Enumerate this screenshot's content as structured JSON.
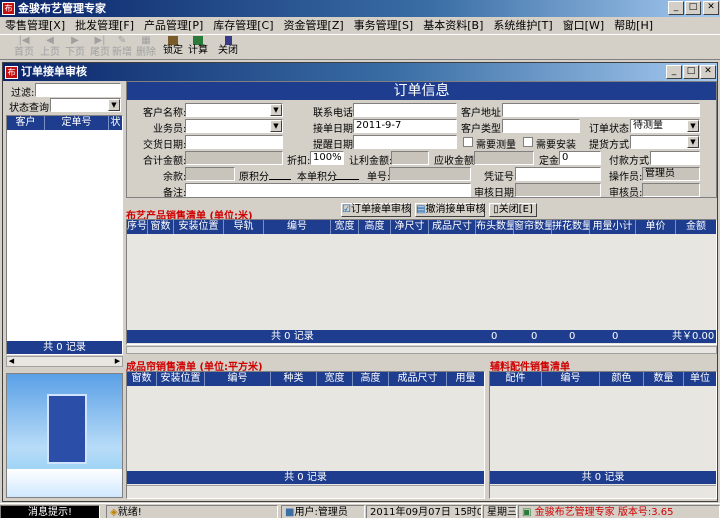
{
  "app": {
    "title": "金骏布艺管理专家"
  },
  "menu": [
    "零售管理[X]",
    "批发管理[F]",
    "产品管理[P]",
    "库存管理[C]",
    "资金管理[Z]",
    "事务管理[S]",
    "基本资料[B]",
    "系统维护[T]",
    "窗口[W]",
    "帮助[H]"
  ],
  "toolbar": {
    "first": "首页",
    "prev": "上页",
    "next": "下页",
    "last": "尾页",
    "add": "新增",
    "delete": "删除",
    "lock": "锁定",
    "calc": "计算",
    "close": "关闭"
  },
  "window": {
    "title": "订单接单审核"
  },
  "left": {
    "filter_label": "过滤:",
    "status_label": "状态查询:",
    "columns": [
      "客户",
      "定单号",
      "状"
    ],
    "footer": "共 0 记录"
  },
  "order": {
    "title": "订单信息",
    "customer_name": "客户名称:",
    "contact_phone": "联系电话:",
    "customer_address": "客户地址:",
    "salesman": "业务员:",
    "order_date": "接单日期:",
    "order_date_value": "2011-9-7",
    "customer_type": "客户类型:",
    "order_status": "订单状态:",
    "order_status_value": "待测量",
    "delivery_date": "交货日期:",
    "remind_date": "提醒日期:",
    "need_measure": "需要测量",
    "need_install": "需要安装",
    "pickup_method": "提货方式:",
    "total_amount": "合计金额:",
    "discount": "折扣:",
    "discount_value": "100%",
    "concession": "让利金额:",
    "receivable": "应收金额:",
    "deposit": "定金:",
    "deposit_value": "0",
    "payment_method": "付款方式:",
    "balance": "余款:",
    "original_points": "原积分",
    "this_points": "本单积分",
    "doc_no": "单号:",
    "voucher_no": "凭证号:",
    "operator": "操作员:",
    "operator_value": "管理员",
    "remark": "备注:",
    "audit_date": "审核日期:",
    "auditor": "审核员:"
  },
  "fabric": {
    "title": "布艺产品销售清单 (单位:米)",
    "btn_audit": "订单接单审核",
    "btn_cancel": "撤消接单审核",
    "btn_close": "关闭[E]",
    "columns": [
      "序号",
      "窗数",
      "安装位置",
      "导轨",
      "编号",
      "宽度",
      "高度",
      "净尺寸",
      "成品尺寸",
      "布头数量",
      "窗帘数量",
      "拼花数量",
      "用量小计",
      "单价",
      "金额"
    ],
    "footer_count": "共 0 记录",
    "footer_vals": [
      "0",
      "0",
      "0",
      "0"
    ],
    "footer_total": "共￥0.00"
  },
  "curtain": {
    "title": "成品帘销售清单 (单位:平方米)",
    "columns": [
      "窗数",
      "安装位置",
      "编号",
      "种类",
      "宽度",
      "高度",
      "成品尺寸",
      "用量"
    ],
    "footer": "共 0 记录"
  },
  "accessory": {
    "title": "辅料配件销售清单",
    "columns": [
      "配件",
      "编号",
      "颜色",
      "数量",
      "单位"
    ],
    "footer": "共 0 记录"
  },
  "status": {
    "hint": "消息提示!",
    "ready": "就绪!",
    "user": "用户:管理员",
    "datetime": "2011年09月07日  15时06分44秒",
    "weekday": "星期三",
    "brand": "金骏布艺管理专家  版本号:3.65"
  }
}
